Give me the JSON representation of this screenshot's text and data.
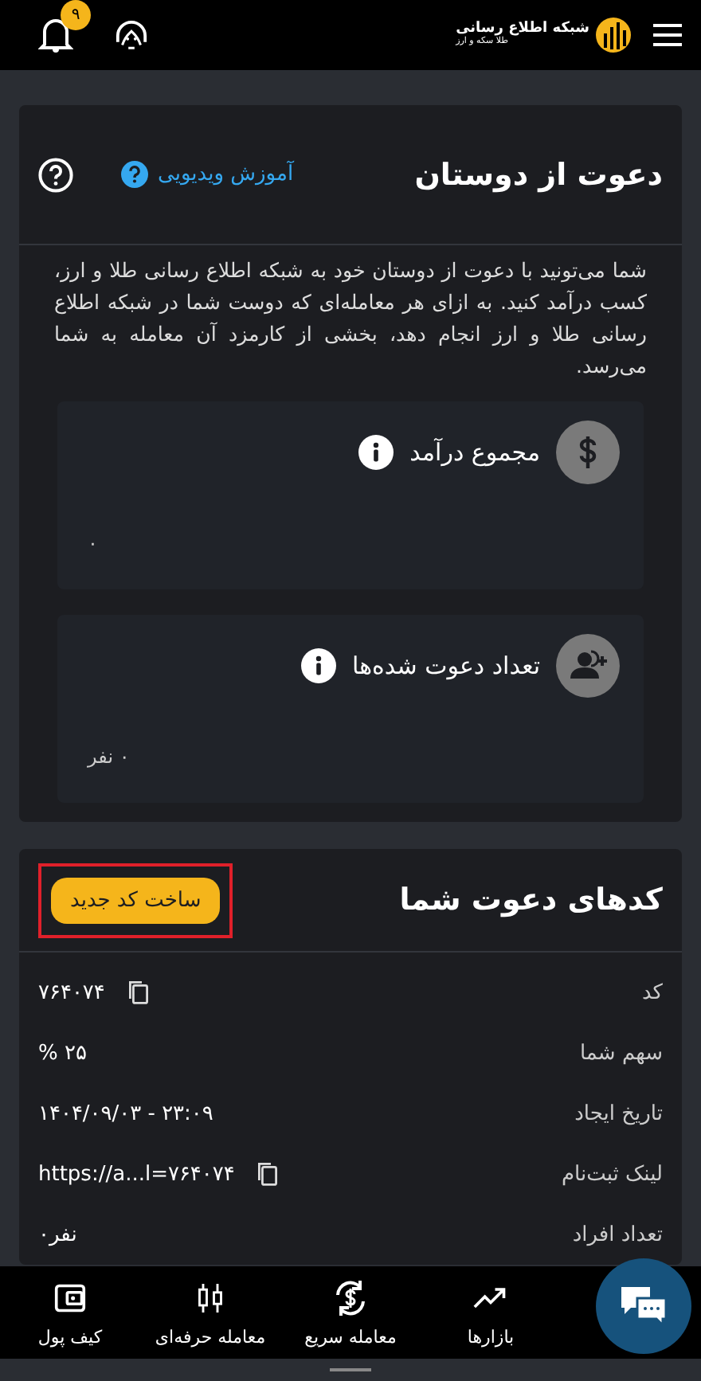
{
  "header": {
    "notifications": "۹",
    "logo": {
      "title": "شبکه اطلاع رسانی",
      "subtitle": "طلا سکه و ارز"
    }
  },
  "invite": {
    "title": "دعوت از دوستان",
    "video_link": "آموزش ویدیویی",
    "description": "شما می‌تونید با دعوت از دوستان خود به شبکه اطلاع رسانی طلا و ارز، کسب درآمد کنید. به ازای هر معامله‌ای که دوست شما در شبکه اطلاع رسانی طلا و ارز انجام دهد، بخشی از کارمزد آن معامله به شما می‌رسد.",
    "stats": [
      {
        "kind": "income",
        "label": "مجموع درآمد",
        "value": "۰"
      },
      {
        "kind": "invited",
        "label": "تعداد دعوت شده‌ها",
        "value": "۰ نفر"
      }
    ]
  },
  "codes": {
    "title": "کدهای دعوت شما",
    "new_button": {
      "label": "ساخت کد جدید",
      "highlighted": true
    },
    "rows": [
      {
        "label": "کد",
        "value": "۷۶۴۰۷۴",
        "copy": true
      },
      {
        "label": "سهم شما",
        "value": "% ۲۵",
        "copy": false
      },
      {
        "label": "تاریخ ایجاد",
        "value": "۱۴۰۴/۰۹/۰۳ - ۲۳:۰۹",
        "copy": false
      },
      {
        "label": "لینک ثبت‌نام",
        "value": "https://a...l=۷۶۴۰۷۴",
        "copy": true
      },
      {
        "label": "تعداد افراد",
        "value": "۰نفر",
        "copy": false
      }
    ]
  },
  "bottom_nav": [
    {
      "kind": "markets",
      "label": "بازارها"
    },
    {
      "kind": "quick",
      "label": "معامله سریع"
    },
    {
      "kind": "pro",
      "label": "معامله حرفه‌ای"
    },
    {
      "kind": "wallet",
      "label": "کیف پول"
    }
  ]
}
